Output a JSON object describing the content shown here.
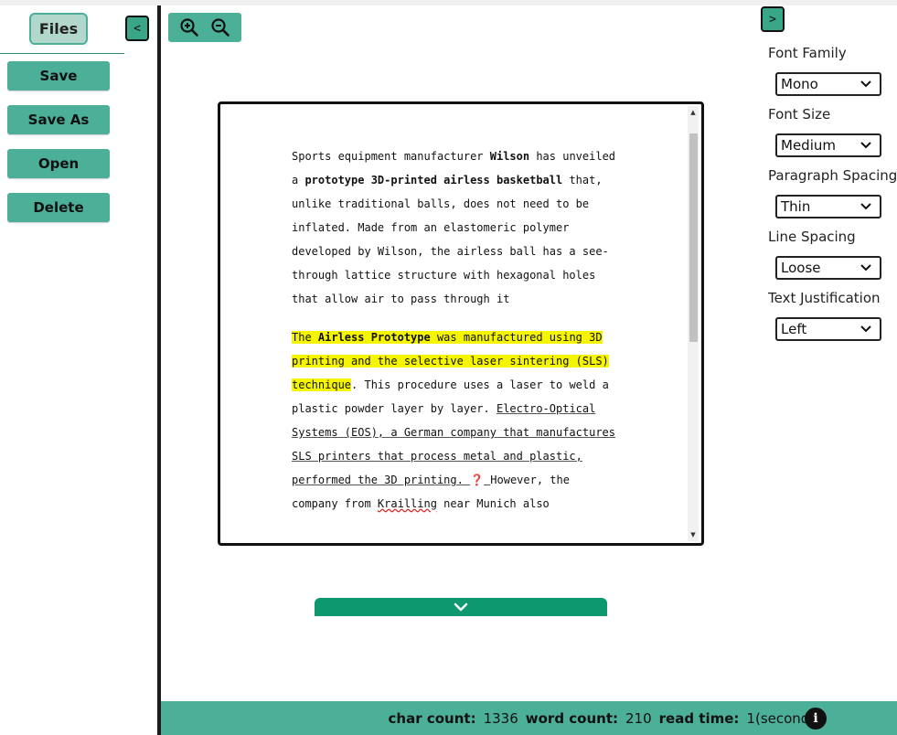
{
  "sidebar": {
    "files_tab": "Files",
    "collapse_label": "<",
    "buttons": {
      "save": "Save",
      "save_as": "Save As",
      "open": "Open",
      "delete": "Delete"
    }
  },
  "toolbar": {
    "zoom_in_icon": "zoom-in-icon",
    "zoom_out_icon": "zoom-out-icon"
  },
  "editor": {
    "p1": {
      "t1": "Sports equipment manufacturer ",
      "b1": "Wilson",
      "t2": " has unveiled a ",
      "b2": "prototype 3D-printed airless basketball",
      "t3": " that, unlike traditional balls, does not need to be inflated. Made from an elastomeric polymer developed by Wilson, the airless ball has a see-through lattice structure with hexagonal holes that allow air to pass through it"
    },
    "p2": {
      "h1": "The ",
      "hb": "Airless Prototype",
      "h2": " was manufactured using 3D printing and the selective laser sintering (SLS) technique",
      "t1": ". This procedure uses a laser to weld a plastic powder layer by layer. ",
      "u1": "Electro-Optical Systems (EOS), a German company that manufactures SLS printers that process metal and plastic, performed the 3D printing. ",
      "q": "❓",
      "u2": " ",
      "t2": "However, the company from ",
      "sp": "Krailling",
      "t3": " near Munich also"
    }
  },
  "right_panel": {
    "collapse_label": ">",
    "options": [
      {
        "label": "Font Family",
        "value": "Mono"
      },
      {
        "label": "Font Size",
        "value": "Medium"
      },
      {
        "label": "Paragraph Spacing",
        "value": "Thin"
      },
      {
        "label": "Line Spacing",
        "value": "Loose"
      },
      {
        "label": "Text Justification",
        "value": "Left"
      }
    ]
  },
  "status": {
    "char_label": "char count:",
    "char_value": "1336",
    "word_label": "word count:",
    "word_value": "210",
    "read_label": "read time:",
    "read_value": "1(seconds)",
    "info_glyph": "i"
  },
  "colors": {
    "accent": "#4caf98",
    "accent_dark": "#0e9870",
    "highlight": "#f5f500"
  }
}
